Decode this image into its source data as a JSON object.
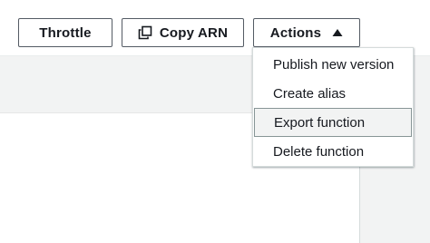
{
  "toolbar": {
    "throttle_label": "Throttle",
    "copy_arn_label": "Copy ARN",
    "actions_label": "Actions",
    "copy_icon": "copy-icon",
    "actions_caret_icon": "caret-up-icon"
  },
  "actions_menu": {
    "expanded": true,
    "items": [
      {
        "label": "Publish new version",
        "highlighted": false
      },
      {
        "label": "Create alias",
        "highlighted": false
      },
      {
        "label": "Export function",
        "highlighted": true
      },
      {
        "label": "Delete function",
        "highlighted": false
      }
    ]
  },
  "colors": {
    "button_border": "#545b64",
    "text": "#16191f",
    "page_background": "#f2f3f3",
    "highlight_background": "#f2f3f3",
    "highlight_border": "#879596"
  }
}
